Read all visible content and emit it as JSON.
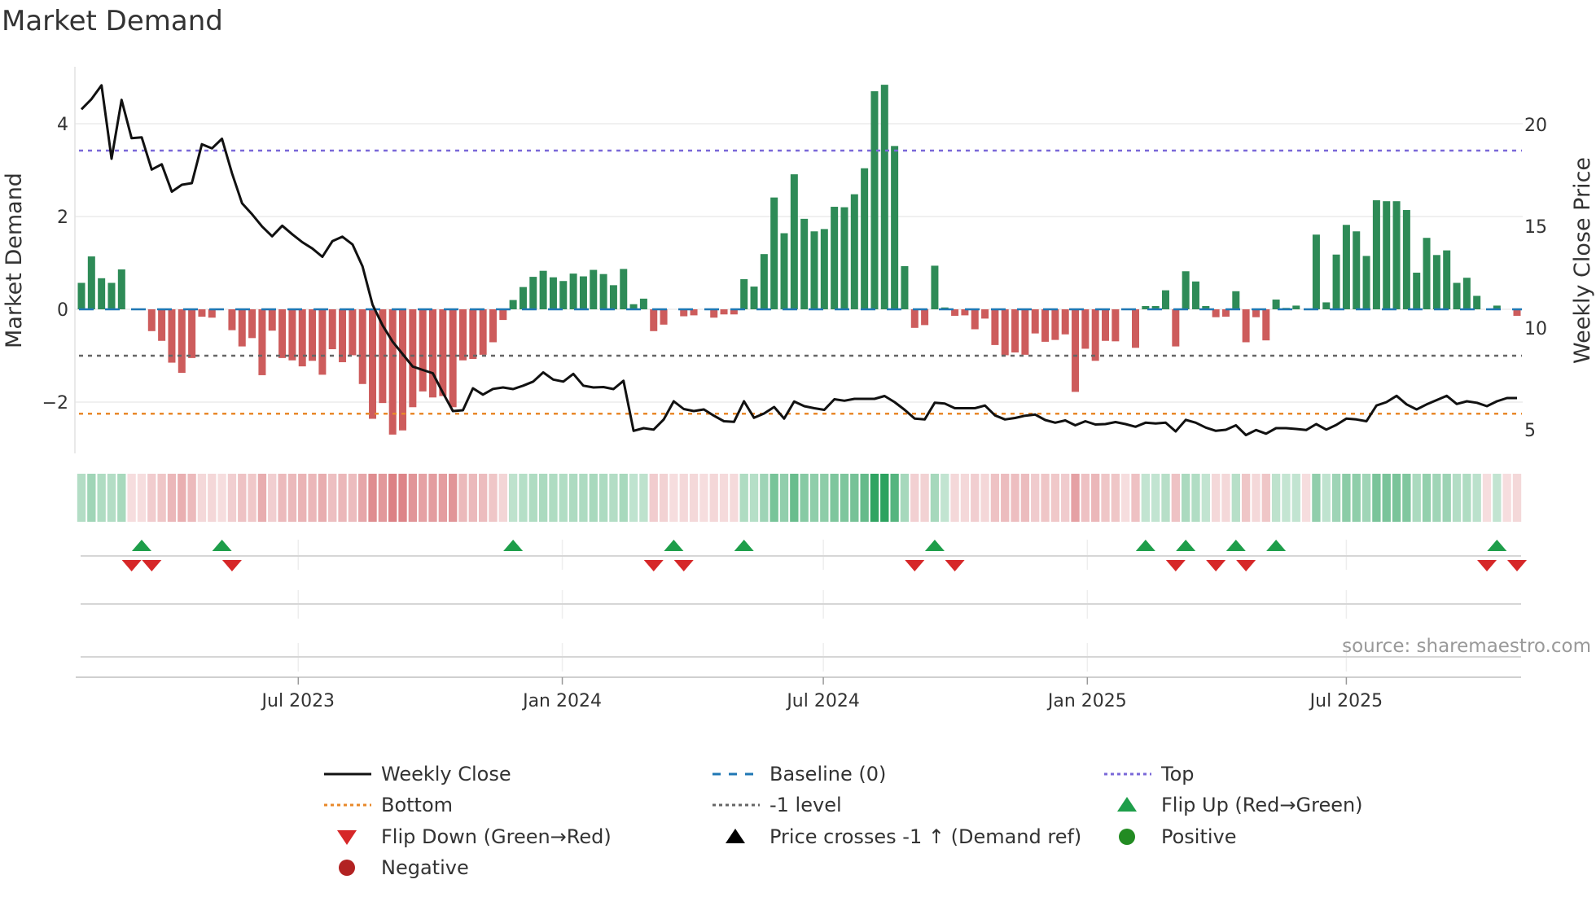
{
  "title": "Market Demand",
  "source": "source: sharemaestro.com",
  "colors": {
    "positive_bar": "#2e8b57",
    "negative_bar": "#cd5c5c",
    "price_line": "#111111",
    "baseline": "#1f77b4",
    "top": "#7a68d8",
    "bottom": "#e8892b",
    "minus_one": "#666666",
    "flip_up": "#1e9e4a",
    "flip_down": "#d62728",
    "strip_positive": "#2ca25f",
    "strip_negative": "#d0575c"
  },
  "chart_data": {
    "type": "bar+line",
    "title": "Market Demand",
    "xlabel": "",
    "ylabel": "Market Demand",
    "y2label": "Weekly Close Price",
    "ylim": [
      -3.2,
      5.0
    ],
    "y2lim": [
      3.9,
      22.4
    ],
    "yticks": [
      {
        "v": 4,
        "label": "4"
      },
      {
        "v": 2,
        "label": "2"
      },
      {
        "v": 0,
        "label": "0"
      },
      {
        "v": -2,
        "label": "−2"
      }
    ],
    "y2ticks": [
      {
        "v": 20,
        "label": "20"
      },
      {
        "v": 15,
        "label": "15"
      },
      {
        "v": 10,
        "label": "10"
      },
      {
        "v": 5,
        "label": "5"
      }
    ],
    "xticks": [
      {
        "week": 21.6,
        "label": "Jul 2023"
      },
      {
        "week": 47.9,
        "label": "Jan 2024"
      },
      {
        "week": 73.9,
        "label": "Jul 2024"
      },
      {
        "week": 100.2,
        "label": "Jan 2025"
      },
      {
        "week": 126,
        "label": "Jul 2025"
      }
    ],
    "levels": {
      "top": 3.42,
      "bottom": -2.25,
      "minus_one": -1,
      "baseline": 0
    },
    "demand": [
      0.57,
      1.14,
      0.67,
      0.57,
      0.86,
      0,
      0,
      -0.47,
      -0.68,
      -1.15,
      -1.37,
      -1.05,
      -0.16,
      -0.18,
      0,
      -0.45,
      -0.8,
      -0.62,
      -1.42,
      -0.46,
      -1.05,
      -1.1,
      -1.23,
      -1.11,
      -1.41,
      -0.86,
      -1.14,
      -0.99,
      -1.61,
      -2.36,
      -2.02,
      -2.7,
      -2.61,
      -2.11,
      -1.77,
      -1.9,
      -1.87,
      -2.11,
      -1.1,
      -1.07,
      -0.98,
      -0.71,
      -0.23,
      0.2,
      0.48,
      0.7,
      0.83,
      0.69,
      0.61,
      0.77,
      0.71,
      0.85,
      0.76,
      0.52,
      0.87,
      0.11,
      0.23,
      -0.47,
      -0.33,
      0,
      -0.15,
      -0.13,
      0,
      -0.18,
      -0.11,
      -0.11,
      0.65,
      0.49,
      1.19,
      2.41,
      1.64,
      2.91,
      1.95,
      1.68,
      1.73,
      2.21,
      2.2,
      2.48,
      3.04,
      4.7,
      4.84,
      3.52,
      0.93,
      -0.4,
      -0.34,
      0.94,
      0.04,
      -0.14,
      -0.13,
      -0.43,
      -0.2,
      -0.77,
      -0.99,
      -0.93,
      -0.98,
      -0.52,
      -0.7,
      -0.66,
      -0.54,
      -1.78,
      -0.85,
      -1.11,
      -0.68,
      -0.69,
      0,
      -0.83,
      0.07,
      0.07,
      0.41,
      -0.8,
      0.82,
      0.6,
      0.07,
      -0.17,
      -0.16,
      0.39,
      -0.71,
      -0.17,
      -0.67,
      0.21,
      0.03,
      0.08,
      0,
      1.61,
      0.15,
      1.18,
      1.82,
      1.68,
      1.15,
      2.35,
      2.33,
      2.33,
      2.14,
      0.79,
      1.54,
      1.17,
      1.27,
      0.57,
      0.68,
      0.29,
      0,
      0.08,
      0,
      -0.14
    ],
    "price": [
      20.75,
      21.25,
      21.93,
      18.32,
      21.21,
      19.33,
      19.37,
      17.79,
      18.05,
      16.7,
      17.04,
      17.12,
      19.03,
      18.83,
      19.3,
      17.61,
      16.13,
      15.59,
      14.99,
      14.51,
      15.03,
      14.61,
      14.22,
      13.91,
      13.5,
      14.27,
      14.49,
      14.11,
      13.03,
      11.15,
      10.13,
      9.33,
      8.72,
      8.11,
      7.94,
      7.78,
      6.83,
      5.92,
      5.96,
      7.04,
      6.73,
      7.01,
      7.08,
      7.0,
      7.17,
      7.37,
      7.82,
      7.47,
      7.37,
      7.75,
      7.17,
      7.08,
      7.1,
      7.0,
      7.41,
      4.95,
      5.08,
      5.01,
      5.51,
      6.4,
      6.02,
      5.92,
      6.0,
      5.69,
      5.42,
      5.39,
      6.4,
      5.59,
      5.8,
      6.12,
      5.55,
      6.39,
      6.16,
      6.06,
      5.98,
      6.5,
      6.43,
      6.52,
      6.52,
      6.52,
      6.66,
      6.36,
      5.98,
      5.55,
      5.51,
      6.33,
      6.29,
      6.06,
      6.06,
      6.06,
      6.19,
      5.71,
      5.51,
      5.58,
      5.69,
      5.75,
      5.48,
      5.35,
      5.46,
      5.22,
      5.42,
      5.26,
      5.28,
      5.38,
      5.28,
      5.15,
      5.35,
      5.31,
      5.35,
      4.92,
      5.49,
      5.35,
      5.11,
      4.95,
      5.0,
      5.22,
      4.74,
      4.99,
      4.81,
      5.08,
      5.08,
      5.04,
      4.99,
      5.28,
      5.01,
      5.24,
      5.55,
      5.51,
      5.42,
      6.19,
      6.36,
      6.67,
      6.25,
      6.0,
      6.25,
      6.46,
      6.67,
      6.27,
      6.4,
      6.33,
      6.16,
      6.4,
      6.56,
      6.56
    ],
    "flip_up_weeks": [
      6,
      14,
      43,
      59,
      66,
      85,
      106,
      110,
      115,
      119,
      141
    ],
    "flip_down_weeks": [
      5,
      7,
      15,
      57,
      60,
      83,
      87,
      109,
      113,
      116,
      140,
      143
    ]
  },
  "legend": [
    {
      "label": "Weekly Close",
      "kind": "line",
      "color": "#111111",
      "dash": ""
    },
    {
      "label": "Baseline (0)",
      "kind": "line",
      "color": "#1f77b4",
      "dash": "10,10"
    },
    {
      "label": "Top",
      "kind": "line",
      "color": "#7a68d8",
      "dash": "4,4"
    },
    {
      "label": "Bottom",
      "kind": "line",
      "color": "#e8892b",
      "dash": "4,4"
    },
    {
      "label": "-1 level",
      "kind": "line",
      "color": "#666666",
      "dash": "4,4"
    },
    {
      "label": "Flip Up (Red→Green)",
      "kind": "tri-up",
      "color": "#1e9e4a"
    },
    {
      "label": "Flip Down (Green→Red)",
      "kind": "tri-down",
      "color": "#d62728"
    },
    {
      "label": "Price crosses -1 ↑ (Demand ref)",
      "kind": "tri-up",
      "color": "#000000"
    },
    {
      "label": "Positive",
      "kind": "dot",
      "color": "#228b22"
    },
    {
      "label": "Negative",
      "kind": "dot",
      "color": "#b22222"
    }
  ]
}
